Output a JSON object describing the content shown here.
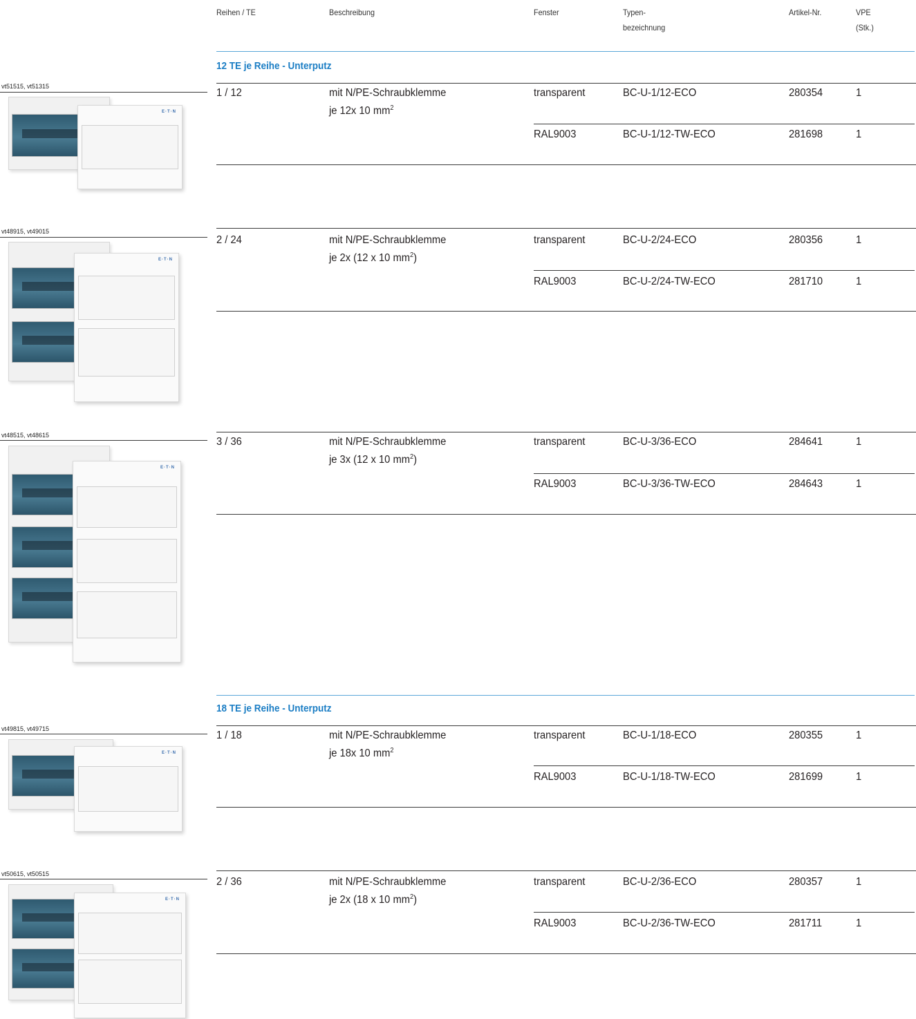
{
  "headers": {
    "reihen": "Reihen / TE",
    "beschreibung": "Beschreibung",
    "fenster": "Fenster",
    "typ1": "Typen-",
    "typ2": "bezeichnung",
    "artikel": "Artikel-Nr.",
    "vpe1": "VPE",
    "vpe2": "(Stk.)"
  },
  "sections": [
    {
      "title": "12 TE je Reihe - Unterputz"
    },
    {
      "title": "18 TE je Reihe - Unterputz"
    }
  ],
  "products": [
    {
      "image_label": "vt51515, vt51315",
      "reihen": "1 / 12",
      "desc1": "mit N/PE-Schraubklemme",
      "desc2": "je 12x 10 mm",
      "desc2_sup": "2",
      "desc2_tail": "",
      "variants": [
        {
          "fenster": "transparent",
          "typ": "BC-U-1/12-ECO",
          "artikel": "280354",
          "vpe": "1"
        },
        {
          "fenster": "RAL9003",
          "typ": "BC-U-1/12-TW-ECO",
          "artikel": "281698",
          "vpe": "1"
        }
      ]
    },
    {
      "image_label": "vt48915, vt49015",
      "reihen": "2 / 24",
      "desc1": "mit N/PE-Schraubklemme",
      "desc2": "je 2x (12 x 10 mm",
      "desc2_sup": "2",
      "desc2_tail": ")",
      "variants": [
        {
          "fenster": "transparent",
          "typ": "BC-U-2/24-ECO",
          "artikel": "280356",
          "vpe": "1"
        },
        {
          "fenster": "RAL9003",
          "typ": "BC-U-2/24-TW-ECO",
          "artikel": "281710",
          "vpe": "1"
        }
      ]
    },
    {
      "image_label": "vt48515, vt48615",
      "reihen": "3 / 36",
      "desc1": "mit N/PE-Schraubklemme",
      "desc2": "je 3x (12 x 10 mm",
      "desc2_sup": "2",
      "desc2_tail": ")",
      "variants": [
        {
          "fenster": "transparent",
          "typ": "BC-U-3/36-ECO",
          "artikel": "284641",
          "vpe": "1"
        },
        {
          "fenster": "RAL9003",
          "typ": "BC-U-3/36-TW-ECO",
          "artikel": "284643",
          "vpe": "1"
        }
      ]
    },
    {
      "image_label": "vt49815, vt49715",
      "reihen": "1 / 18",
      "desc1": "mit N/PE-Schraubklemme",
      "desc2": "je 18x 10 mm",
      "desc2_sup": "2",
      "desc2_tail": "",
      "variants": [
        {
          "fenster": "transparent",
          "typ": "BC-U-1/18-ECO",
          "artikel": "280355",
          "vpe": "1"
        },
        {
          "fenster": "RAL9003",
          "typ": "BC-U-1/18-TW-ECO",
          "artikel": "281699",
          "vpe": "1"
        }
      ]
    },
    {
      "image_label": "vt50615, vt50515",
      "reihen": "2 / 36",
      "desc1": "mit N/PE-Schraubklemme",
      "desc2": "je 2x (18 x 10 mm",
      "desc2_sup": "2",
      "desc2_tail": ")",
      "variants": [
        {
          "fenster": "transparent",
          "typ": "BC-U-2/36-ECO",
          "artikel": "280357",
          "vpe": "1"
        },
        {
          "fenster": "RAL9003",
          "typ": "BC-U-2/36-TW-ECO",
          "artikel": "281711",
          "vpe": "1"
        }
      ]
    }
  ],
  "logo_text": "E·T·N",
  "colors": {
    "section_title": "#1a7dc4",
    "section_rule": "#5aa6d8",
    "rule": "#3a3a3a",
    "window_tint": "#3e6d84"
  }
}
